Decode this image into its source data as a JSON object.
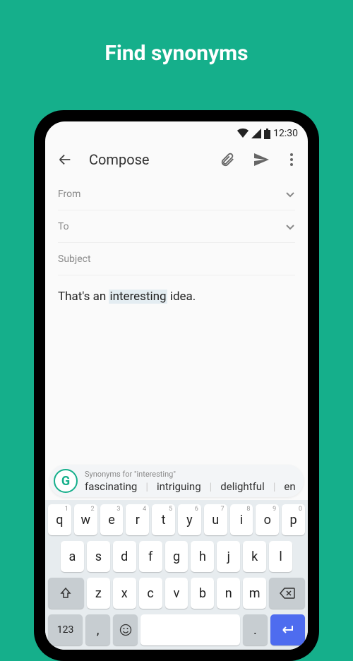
{
  "headline": "Find synonyms",
  "status": {
    "time": "12:30"
  },
  "appbar": {
    "title": "Compose"
  },
  "fields": {
    "from": "From",
    "to": "To",
    "subject": "Subject"
  },
  "body": {
    "before": "That's an ",
    "highlight": "interesting",
    "after": " idea."
  },
  "suggestions": {
    "title": "Synonyms for \"interesting\"",
    "items": [
      "fascinating",
      "intriguing",
      "delightful",
      "en"
    ]
  },
  "keyboard": {
    "row1": [
      {
        "k": "q",
        "n": "1"
      },
      {
        "k": "w",
        "n": "2"
      },
      {
        "k": "e",
        "n": "3"
      },
      {
        "k": "r",
        "n": "4"
      },
      {
        "k": "t",
        "n": "5"
      },
      {
        "k": "y",
        "n": "6"
      },
      {
        "k": "u",
        "n": "7"
      },
      {
        "k": "i",
        "n": "8"
      },
      {
        "k": "o",
        "n": "9"
      },
      {
        "k": "p",
        "n": "0"
      }
    ],
    "row2": [
      "a",
      "s",
      "d",
      "f",
      "g",
      "h",
      "j",
      "k",
      "l"
    ],
    "row3": [
      "z",
      "x",
      "c",
      "v",
      "b",
      "n",
      "m"
    ],
    "num_key": "123",
    "comma": ",",
    "period": "."
  }
}
